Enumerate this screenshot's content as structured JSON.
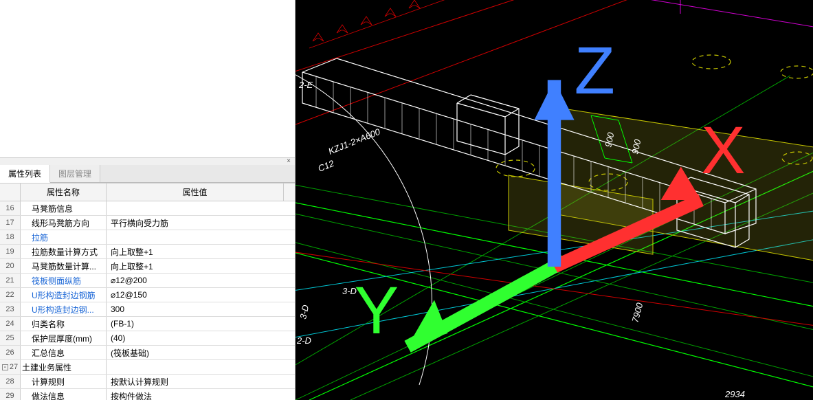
{
  "panel": {
    "tabs": [
      {
        "label": "属性列表",
        "active": true
      },
      {
        "label": "图层管理",
        "active": false
      }
    ],
    "columns": {
      "name": "属性名称",
      "value": "属性值"
    },
    "rows": [
      {
        "num": "16",
        "name": "马凳筋信息",
        "value": "",
        "indent": 1
      },
      {
        "num": "17",
        "name": "线形马凳筋方向",
        "value": "平行横向受力筋",
        "indent": 1
      },
      {
        "num": "18",
        "name": "拉筋",
        "value": "",
        "indent": 1,
        "link": true
      },
      {
        "num": "19",
        "name": "拉筋数量计算方式",
        "value": "向上取整+1",
        "indent": 1
      },
      {
        "num": "20",
        "name": "马凳筋数量计算...",
        "value": "向上取整+1",
        "indent": 1
      },
      {
        "num": "21",
        "name": "筏板侧面纵筋",
        "value": "⌀12@200",
        "indent": 1,
        "link": true
      },
      {
        "num": "22",
        "name": "U形构造封边钢筋",
        "value": "⌀12@150",
        "indent": 1,
        "link": true
      },
      {
        "num": "23",
        "name": "U形构造封边钢...",
        "value": "300",
        "indent": 1,
        "link": true
      },
      {
        "num": "24",
        "name": "归类名称",
        "value": "(FB-1)",
        "indent": 1
      },
      {
        "num": "25",
        "name": "保护层厚度(mm)",
        "value": "(40)",
        "indent": 1
      },
      {
        "num": "26",
        "name": "汇总信息",
        "value": "(筏板基础)",
        "indent": 1
      },
      {
        "num": "27",
        "name": "土建业务属性",
        "value": "",
        "group": true,
        "expand": "-"
      },
      {
        "num": "28",
        "name": "计算规则",
        "value": "按默认计算规则",
        "indent": 1
      },
      {
        "num": "29",
        "name": "做法信息",
        "value": "按构件做法",
        "indent": 1
      }
    ]
  },
  "viewport": {
    "labels": {
      "kzj": "KZJ1-2×A600",
      "c12": "C12",
      "d3": "3-D",
      "d3v": "3-D",
      "d2": "2-D",
      "e2": "2-E",
      "dim900a": "900",
      "dim900b": "900",
      "dim7900": "7900",
      "dim2934": "2934"
    },
    "axes": {
      "x": "X",
      "y": "Y",
      "z": "Z"
    }
  }
}
